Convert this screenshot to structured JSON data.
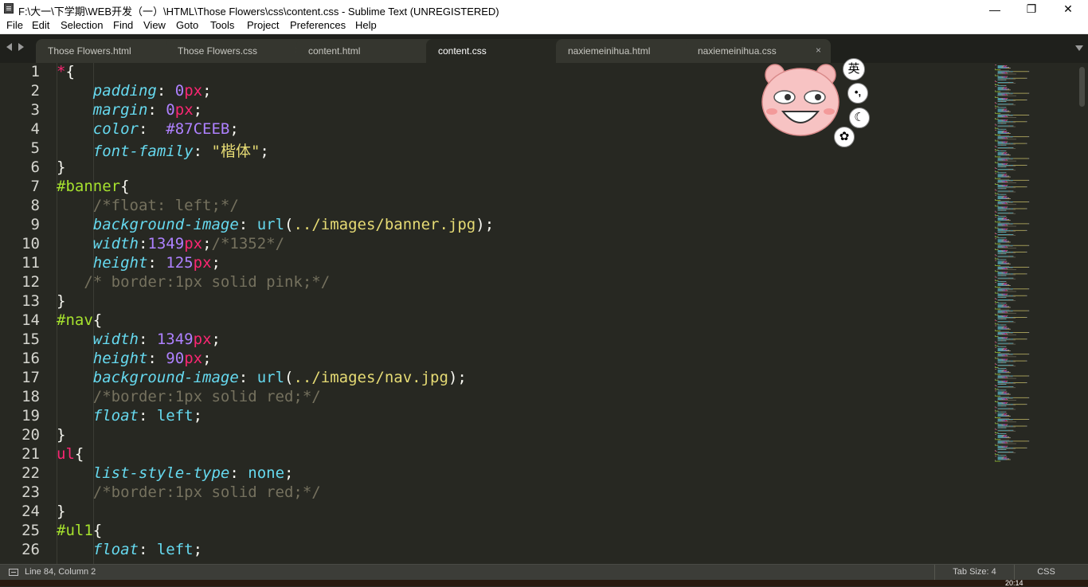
{
  "window": {
    "title": "F:\\大一\\下学期\\WEB开发（一）\\HTML\\Those Flowers\\css\\content.css - Sublime Text (UNREGISTERED)",
    "minimize": "—",
    "maximize": "❐",
    "close": "✕"
  },
  "menu": [
    "File",
    "Edit",
    "Selection",
    "Find",
    "View",
    "Goto",
    "Tools",
    "Project",
    "Preferences",
    "Help"
  ],
  "tabs": [
    {
      "label": "Those Flowers.html",
      "active": false
    },
    {
      "label": "Those Flowers.css",
      "active": false
    },
    {
      "label": "content.html",
      "active": false
    },
    {
      "label": "content.css",
      "active": true
    },
    {
      "label": "naxiemeinihua.html",
      "active": false
    },
    {
      "label": "naxiemeinihua.css",
      "active": false
    }
  ],
  "tab_close_glyph": "×",
  "editor": {
    "lines": [
      [
        [
          "*",
          "sel"
        ],
        [
          "{",
          "p"
        ]
      ],
      [
        [
          "    ",
          "p"
        ],
        [
          "padding",
          "prop"
        ],
        [
          ": ",
          "p"
        ],
        [
          "0",
          "num"
        ],
        [
          "px",
          "unit"
        ],
        [
          ";",
          "p"
        ]
      ],
      [
        [
          "    ",
          "p"
        ],
        [
          "margin",
          "prop"
        ],
        [
          ": ",
          "p"
        ],
        [
          "0",
          "num"
        ],
        [
          "px",
          "unit"
        ],
        [
          ";",
          "p"
        ]
      ],
      [
        [
          "    ",
          "p"
        ],
        [
          "color",
          "prop"
        ],
        [
          ":  ",
          "p"
        ],
        [
          "#87CEEB",
          "num"
        ],
        [
          ";",
          "p"
        ]
      ],
      [
        [
          "    ",
          "p"
        ],
        [
          "font-family",
          "prop"
        ],
        [
          ": ",
          "p"
        ],
        [
          "\"楷体\"",
          "str"
        ],
        [
          ";",
          "p"
        ]
      ],
      [
        [
          "}",
          "p"
        ]
      ],
      [
        [
          "#banner",
          "id"
        ],
        [
          "{",
          "p"
        ]
      ],
      [
        [
          "    ",
          "p"
        ],
        [
          "/*float: left;*/",
          "cmt"
        ]
      ],
      [
        [
          "    ",
          "p"
        ],
        [
          "background-image",
          "prop"
        ],
        [
          ": ",
          "p"
        ],
        [
          "url",
          "url"
        ],
        [
          "(",
          "p"
        ],
        [
          "../images/banner.jpg",
          "str"
        ],
        [
          ");",
          "p"
        ]
      ],
      [
        [
          "    ",
          "p"
        ],
        [
          "width",
          "prop"
        ],
        [
          ":",
          "p"
        ],
        [
          "1349",
          "num"
        ],
        [
          "px",
          "unit"
        ],
        [
          ";",
          "p"
        ],
        [
          "/*1352*/",
          "cmt"
        ]
      ],
      [
        [
          "    ",
          "p"
        ],
        [
          "height",
          "prop"
        ],
        [
          ": ",
          "p"
        ],
        [
          "125",
          "num"
        ],
        [
          "px",
          "unit"
        ],
        [
          ";",
          "p"
        ]
      ],
      [
        [
          "   ",
          "p"
        ],
        [
          "/* border:1px solid pink;*/",
          "cmt"
        ]
      ],
      [
        [
          "}",
          "p"
        ]
      ],
      [
        [
          "#nav",
          "id"
        ],
        [
          "{",
          "p"
        ]
      ],
      [
        [
          "    ",
          "p"
        ],
        [
          "width",
          "prop"
        ],
        [
          ": ",
          "p"
        ],
        [
          "1349",
          "num"
        ],
        [
          "px",
          "unit"
        ],
        [
          ";",
          "p"
        ]
      ],
      [
        [
          "    ",
          "p"
        ],
        [
          "height",
          "prop"
        ],
        [
          ": ",
          "p"
        ],
        [
          "90",
          "num"
        ],
        [
          "px",
          "unit"
        ],
        [
          ";",
          "p"
        ]
      ],
      [
        [
          "    ",
          "p"
        ],
        [
          "background-image",
          "prop"
        ],
        [
          ": ",
          "p"
        ],
        [
          "url",
          "url"
        ],
        [
          "(",
          "p"
        ],
        [
          "../images/nav.jpg",
          "str"
        ],
        [
          ");",
          "p"
        ]
      ],
      [
        [
          "    ",
          "p"
        ],
        [
          "/*border:1px solid red;*/",
          "cmt"
        ]
      ],
      [
        [
          "    ",
          "p"
        ],
        [
          "float",
          "prop"
        ],
        [
          ": ",
          "p"
        ],
        [
          "left",
          "kw"
        ],
        [
          ";",
          "p"
        ]
      ],
      [
        [
          "}",
          "p"
        ]
      ],
      [
        [
          "ul",
          "sel"
        ],
        [
          "{",
          "p"
        ]
      ],
      [
        [
          "    ",
          "p"
        ],
        [
          "list-style-type",
          "prop"
        ],
        [
          ": ",
          "p"
        ],
        [
          "none",
          "kw"
        ],
        [
          ";",
          "p"
        ]
      ],
      [
        [
          "    ",
          "p"
        ],
        [
          "/*border:1px solid red;*/",
          "cmt"
        ]
      ],
      [
        [
          "}",
          "p"
        ]
      ],
      [
        [
          "#ul1",
          "id"
        ],
        [
          "{",
          "p"
        ]
      ],
      [
        [
          "    ",
          "p"
        ],
        [
          "float",
          "prop"
        ],
        [
          ": ",
          "p"
        ],
        [
          "left",
          "kw"
        ],
        [
          ";",
          "p"
        ]
      ]
    ]
  },
  "ime": {
    "lang": "英",
    "punct": "•,",
    "moon": "☾",
    "butterfly": "✿"
  },
  "status": {
    "position": "Line 84, Column 2",
    "tab_size": "Tab Size: 4",
    "syntax": "CSS"
  },
  "taskbar": {
    "clock": "20:14"
  },
  "colors": {
    "background": "#272822",
    "selector": "#f92672",
    "id_selector": "#a6e22e",
    "property": "#66d9ef",
    "number": "#ae81ff",
    "string": "#e6db74",
    "comment": "#75715e"
  }
}
